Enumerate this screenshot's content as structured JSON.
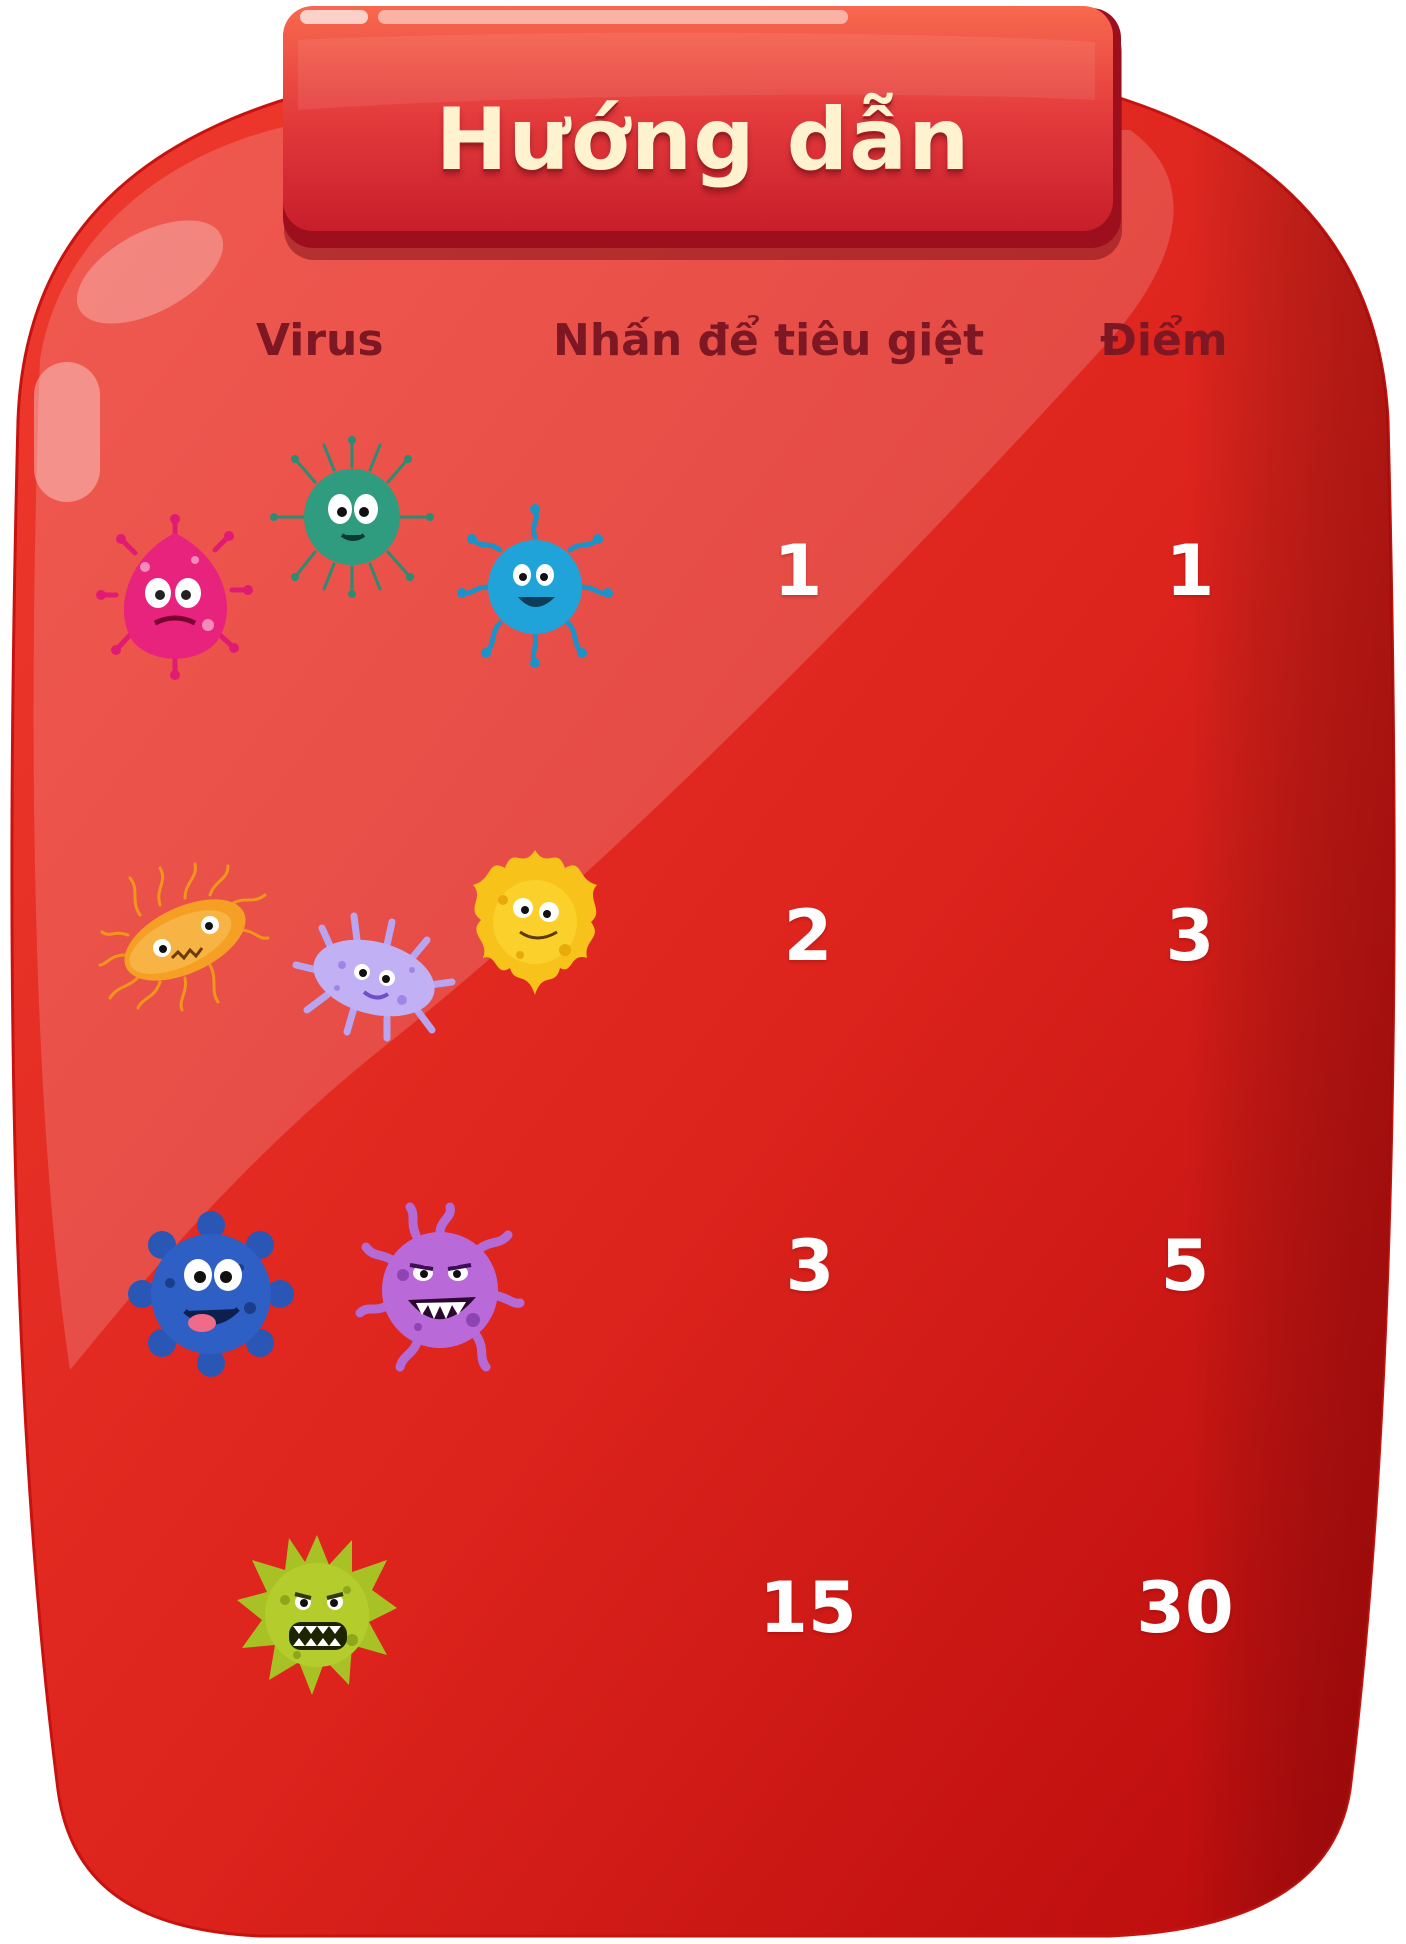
{
  "title": "Hướng dẫn",
  "headers": {
    "virus": "Virus",
    "taps": "Nhấn để tiêu giệt",
    "points": "Điểm"
  },
  "rows": [
    {
      "taps": "1",
      "points": "1",
      "viruses": [
        "pink-virus-icon",
        "teal-virus-icon",
        "blue-virus-icon"
      ]
    },
    {
      "taps": "2",
      "points": "3",
      "viruses": [
        "orange-bacteria-icon",
        "lavender-bacteria-icon",
        "yellow-virus-icon"
      ]
    },
    {
      "taps": "3",
      "points": "5",
      "viruses": [
        "navy-virus-icon",
        "purple-monster-virus-icon"
      ]
    },
    {
      "taps": "15",
      "points": "30",
      "viruses": [
        "lime-monster-virus-icon"
      ]
    }
  ],
  "colors": {
    "jar": "#e0241d",
    "jar_dark": "#b50c0f",
    "lid": "#e0323a",
    "header_text": "#7e1724",
    "title_text": "#fff3cf",
    "number_text": "#ffffff"
  }
}
